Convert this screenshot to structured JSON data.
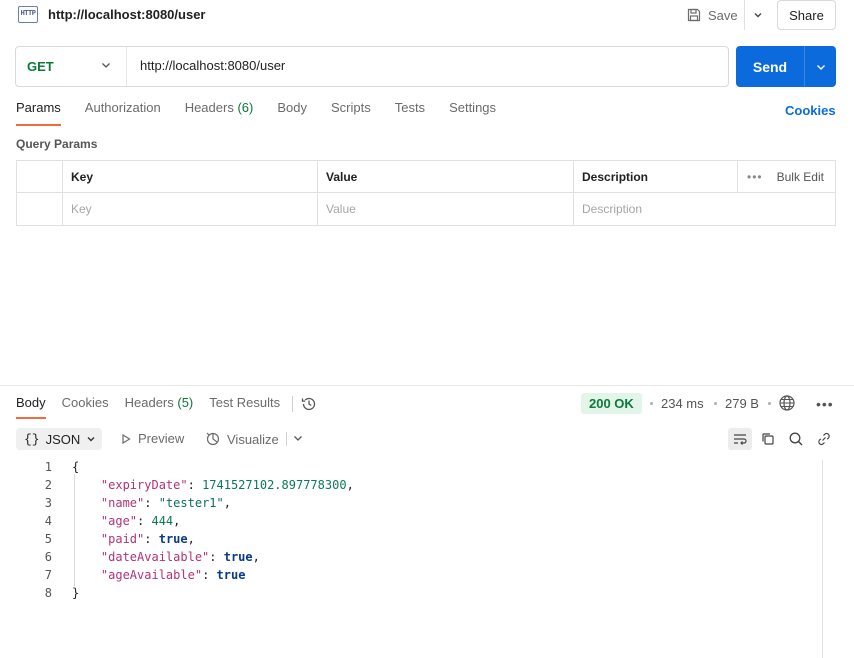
{
  "header": {
    "icon_text": "HTTP",
    "title": "http://localhost:8080/user",
    "save_label": "Save",
    "share_label": "Share"
  },
  "request": {
    "method": "GET",
    "url": "http://localhost:8080/user",
    "send_label": "Send"
  },
  "request_tabs": [
    {
      "label": "Params",
      "count": ""
    },
    {
      "label": "Authorization",
      "count": ""
    },
    {
      "label": "Headers",
      "count": "(6)"
    },
    {
      "label": "Body",
      "count": ""
    },
    {
      "label": "Scripts",
      "count": ""
    },
    {
      "label": "Tests",
      "count": ""
    },
    {
      "label": "Settings",
      "count": ""
    }
  ],
  "cookies_link": "Cookies",
  "query_params": {
    "title": "Query Params",
    "columns": [
      "Key",
      "Value",
      "Description"
    ],
    "bulk_edit": "Bulk Edit",
    "placeholders": [
      "Key",
      "Value",
      "Description"
    ]
  },
  "response_tabs": [
    {
      "label": "Body",
      "count": ""
    },
    {
      "label": "Cookies",
      "count": ""
    },
    {
      "label": "Headers",
      "count": "(5)"
    },
    {
      "label": "Test Results",
      "count": ""
    }
  ],
  "response_meta": {
    "status": "200 OK",
    "time": "234 ms",
    "size": "279 B"
  },
  "response_toolbar": {
    "format": "JSON",
    "preview": "Preview",
    "visualize": "Visualize"
  },
  "code_lines": [
    {
      "n": "1",
      "indent": "",
      "key": "",
      "value": "",
      "type": "",
      "tail": "{"
    },
    {
      "n": "2",
      "indent": "    ",
      "key": "\"expiryDate\"",
      "value": "1741527102.897778300",
      "type": "num",
      "tail": ","
    },
    {
      "n": "3",
      "indent": "    ",
      "key": "\"name\"",
      "value": "\"tester1\"",
      "type": "str",
      "tail": ","
    },
    {
      "n": "4",
      "indent": "    ",
      "key": "\"age\"",
      "value": "444",
      "type": "num",
      "tail": ","
    },
    {
      "n": "5",
      "indent": "    ",
      "key": "\"paid\"",
      "value": "true",
      "type": "bool",
      "tail": ","
    },
    {
      "n": "6",
      "indent": "    ",
      "key": "\"dateAvailable\"",
      "value": "true",
      "type": "bool",
      "tail": ","
    },
    {
      "n": "7",
      "indent": "    ",
      "key": "\"ageAvailable\"",
      "value": "true",
      "type": "bool",
      "tail": ""
    },
    {
      "n": "8",
      "indent": "",
      "key": "",
      "value": "",
      "type": "",
      "tail": "}"
    }
  ],
  "colors": {
    "accent_blue": "#0b6bdc",
    "tab_underline": "#f26b3a",
    "method_green": "#0b7a3a",
    "status_bg": "#e3f4e8"
  }
}
